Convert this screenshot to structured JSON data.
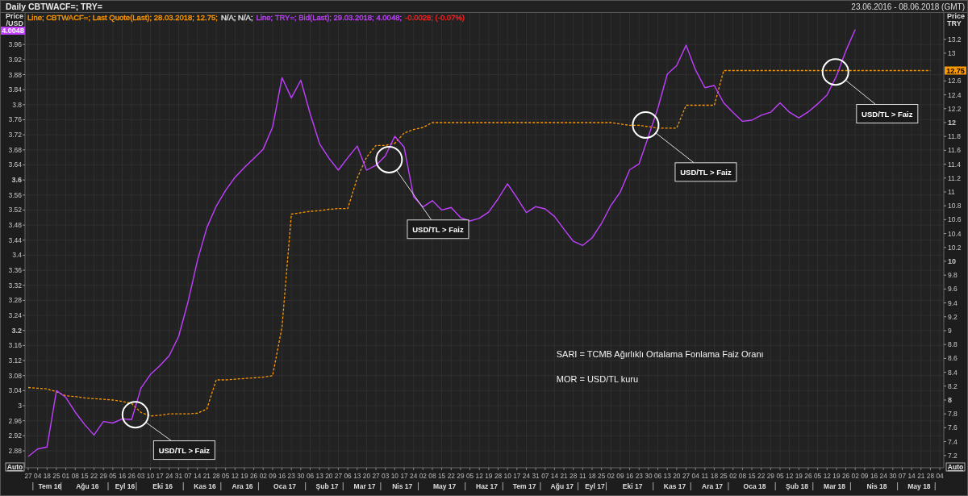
{
  "window": {
    "title": "Daily CBTWACF=; TRY=",
    "date_range": "23.06.2016 - 08.06.2018 (GMT)"
  },
  "legend": [
    {
      "text": "Line; CBTWACF=; Last Quote(Last); 28.03.2018; 12.75;",
      "color": "#ff9900"
    },
    {
      "text": "N/A; N/A;",
      "color": "#e0e0e0"
    },
    {
      "text": "Line; TRY=; Bid(Last); 29.03.2018; 4.0048;",
      "color": "#c040ff"
    },
    {
      "text": "-0.0028; (-0.07%)",
      "color": "#ff2020"
    }
  ],
  "left_axis": {
    "title_lines": [
      "Price",
      "/USD"
    ],
    "badge": "4.0048",
    "auto_button": "Auto"
  },
  "right_axis": {
    "title_lines": [
      "Price",
      "TRY"
    ],
    "badge": "12.75",
    "auto_button": "Auto"
  },
  "x_axis": {
    "months": [
      "Tem 16",
      "Ağu 16",
      "Eyl 16",
      "Eki 16",
      "Kas 16",
      "Ara 16",
      "Oca 17",
      "Şub 17",
      "Mar 17",
      "Nis 17",
      "May 17",
      "Haz 17",
      "Tem 17",
      "Ağu 17",
      "Eyl 17",
      "Eki 17",
      "Kas 17",
      "Ara 17",
      "Oca 18",
      "Şub 18",
      "Mar 18",
      "Nis 18",
      "May 18"
    ]
  },
  "chart": {
    "chart_data": {
      "type": "line",
      "categories": [
        "27",
        "04",
        "18",
        "25",
        "01",
        "08",
        "15",
        "22",
        "29",
        "05",
        "16",
        "26",
        "03",
        "10",
        "17",
        "24",
        "31",
        "07",
        "14",
        "21",
        "28",
        "05",
        "12",
        "19",
        "26",
        "02",
        "09",
        "16",
        "23",
        "30",
        "06",
        "13",
        "20",
        "27",
        "06",
        "13",
        "20",
        "27",
        "03",
        "10",
        "17",
        "24",
        "02",
        "08",
        "15",
        "22",
        "29",
        "05",
        "12",
        "19",
        "28",
        "10",
        "17",
        "24",
        "31",
        "07",
        "14",
        "21",
        "28",
        "11",
        "18",
        "25",
        "02",
        "09",
        "16",
        "23",
        "30",
        "06",
        "13",
        "20",
        "27",
        "04",
        "11",
        "18",
        "25",
        "02",
        "08",
        "15",
        "22",
        "29",
        "05",
        "12",
        "19",
        "26",
        "05",
        "12",
        "19",
        "26",
        "02",
        "09",
        "16",
        "24",
        "30",
        "07",
        "14",
        "21",
        "28",
        "04"
      ],
      "series": [
        {
          "color": "#c040ff",
          "line_style": "solid",
          "values": [
            2.865,
            2.885,
            2.89,
            3.04,
            3.022,
            2.983,
            2.95,
            2.922,
            2.958,
            2.954,
            2.965,
            2.963,
            3.047,
            3.083,
            3.106,
            3.133,
            3.184,
            3.276,
            3.385,
            3.473,
            3.53,
            3.572,
            3.607,
            3.633,
            3.657,
            3.682,
            3.74,
            3.872,
            3.818,
            3.865,
            3.776,
            3.696,
            3.658,
            3.626,
            3.659,
            3.69,
            3.626,
            3.639,
            3.664,
            3.716,
            3.687,
            3.556,
            3.528,
            3.545,
            3.52,
            3.527,
            3.5,
            3.491,
            3.498,
            3.515,
            3.55,
            3.59,
            3.553,
            3.513,
            3.529,
            3.523,
            3.503,
            3.469,
            3.437,
            3.426,
            3.446,
            3.484,
            3.532,
            3.568,
            3.627,
            3.643,
            3.716,
            3.791,
            3.881,
            3.904,
            3.958,
            3.893,
            3.845,
            3.851,
            3.805,
            3.779,
            3.756,
            3.759,
            3.772,
            3.78,
            3.805,
            3.78,
            3.765,
            3.781,
            3.802,
            3.826,
            3.876,
            3.943,
            4.0,
            null,
            null,
            null,
            null,
            null,
            null,
            null,
            null,
            null
          ]
        }
      ],
      "ylim": [
        2.835,
        4.044
      ],
      "yticks": [
        {
          "value": 3.96,
          "label": "3.96"
        },
        {
          "value": 3.92,
          "label": "3.92"
        },
        {
          "value": 3.88,
          "label": "3.88"
        },
        {
          "value": 3.84,
          "label": "3.84"
        },
        {
          "value": 3.8,
          "label": "3.8"
        },
        {
          "value": 3.76,
          "label": "3.76"
        },
        {
          "value": 3.72,
          "label": "3.72"
        },
        {
          "value": 3.68,
          "label": "3.68"
        },
        {
          "value": 3.64,
          "label": "3.64"
        },
        {
          "value": 3.6,
          "label": "3.6"
        },
        {
          "value": 3.56,
          "label": "3.56"
        },
        {
          "value": 3.52,
          "label": "3.52"
        },
        {
          "value": 3.48,
          "label": "3.48"
        },
        {
          "value": 3.44,
          "label": "3.44"
        },
        {
          "value": 3.4,
          "label": "3.4"
        },
        {
          "value": 3.36,
          "label": "3.36"
        },
        {
          "value": 3.32,
          "label": "3.32"
        },
        {
          "value": 3.28,
          "label": "3.28"
        },
        {
          "value": 3.24,
          "label": "3.24"
        },
        {
          "value": 3.2,
          "label": "3.2"
        },
        {
          "value": 3.16,
          "label": "3.16"
        },
        {
          "value": 3.12,
          "label": "3.12"
        },
        {
          "value": 3.08,
          "label": "3.08"
        },
        {
          "value": 3.04,
          "label": "3.04"
        },
        {
          "value": 3,
          "label": "3"
        },
        {
          "value": 2.96,
          "label": "2.96"
        },
        {
          "value": 2.92,
          "label": "2.92"
        },
        {
          "value": 2.88,
          "label": "2.88"
        }
      ]
    },
    "callouts": [
      {
        "text": "USD/TL > Faiz"
      },
      {
        "text": "USD/TL > Faiz"
      },
      {
        "text": "USD/TL > Faiz"
      },
      {
        "text": "USD/TL > Faiz"
      }
    ],
    "notes": [
      "SARI = TCMB Ağırlıklı Ortalama Fonlama Faiz Oranı",
      "MOR = USD/TL kuru"
    ]
  },
  "right_chart": {
    "chart_data": {
      "type": "line",
      "series": [
        {
          "color": "#ff9900",
          "line_style": "dashed",
          "values": [
            8.18,
            8.17,
            8.16,
            8.12,
            8.06,
            8.05,
            8.03,
            8.02,
            8.01,
            8.0,
            7.98,
            7.95,
            7.82,
            7.77,
            7.78,
            7.8,
            7.8,
            7.8,
            7.81,
            7.87,
            8.29,
            8.29,
            8.3,
            8.31,
            8.32,
            8.33,
            8.35,
            9.05,
            10.68,
            10.7,
            10.72,
            10.73,
            10.75,
            10.76,
            10.76,
            11.2,
            11.5,
            11.67,
            11.67,
            11.7,
            11.85,
            11.9,
            11.93,
            12.0,
            12.0,
            12.0,
            12.0,
            12.0,
            12.0,
            12.0,
            12.0,
            12.0,
            12.0,
            12.0,
            12.0,
            12.0,
            12.0,
            12.0,
            12.0,
            12.0,
            12.0,
            12.0,
            12.0,
            11.98,
            11.96,
            11.96,
            11.94,
            11.92,
            11.92,
            11.92,
            12.25,
            12.25,
            12.25,
            12.25,
            12.75,
            12.75,
            12.75,
            12.75,
            12.75,
            12.75,
            12.75,
            12.75,
            12.75,
            12.75,
            12.75,
            12.75,
            12.75,
            12.75,
            12.75,
            12.75,
            12.75,
            12.75,
            12.75,
            12.75,
            12.75,
            12.75,
            12.75,
            null
          ]
        }
      ],
      "ylim": [
        7.023,
        13.581
      ],
      "yticks": [
        {
          "value": 13.2,
          "label": "13.2"
        },
        {
          "value": 13,
          "label": "13"
        },
        {
          "value": 12.6,
          "label": "12.6"
        },
        {
          "value": 12.4,
          "label": "12.4"
        },
        {
          "value": 12.2,
          "label": "12.2"
        },
        {
          "value": 12,
          "label": "12"
        },
        {
          "value": 11.8,
          "label": "11.8"
        },
        {
          "value": 11.6,
          "label": "11.6"
        },
        {
          "value": 11.4,
          "label": "11.4"
        },
        {
          "value": 11.2,
          "label": "11.2"
        },
        {
          "value": 11,
          "label": "11"
        },
        {
          "value": 10.8,
          "label": "10.8"
        },
        {
          "value": 10.6,
          "label": "10.6"
        },
        {
          "value": 10.4,
          "label": "10.4"
        },
        {
          "value": 10.2,
          "label": "10.2"
        },
        {
          "value": 10,
          "label": "10"
        },
        {
          "value": 9.8,
          "label": "9.8"
        },
        {
          "value": 9.6,
          "label": "9.6"
        },
        {
          "value": 9.4,
          "label": "9.4"
        },
        {
          "value": 9.2,
          "label": "9.2"
        },
        {
          "value": 9,
          "label": "9"
        },
        {
          "value": 8.8,
          "label": "8.8"
        },
        {
          "value": 8.6,
          "label": "8.6"
        },
        {
          "value": 8.4,
          "label": "8.4"
        },
        {
          "value": 8.2,
          "label": "8.2"
        },
        {
          "value": 8,
          "label": "8"
        },
        {
          "value": 7.8,
          "label": "7.8"
        },
        {
          "value": 7.6,
          "label": "7.6"
        },
        {
          "value": 7.4,
          "label": "7.4"
        },
        {
          "value": 7.2,
          "label": "7.2"
        }
      ]
    }
  }
}
